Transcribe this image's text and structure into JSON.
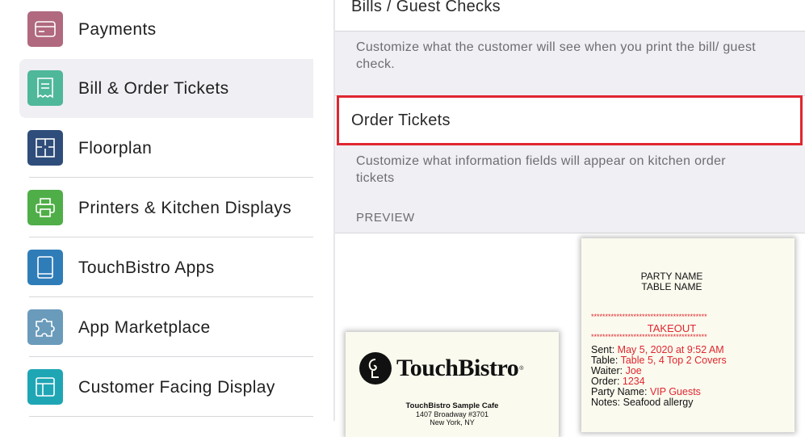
{
  "sidebar": {
    "items": [
      {
        "label": "Payments",
        "icon": "credit-card-icon",
        "color": "#b0697f",
        "selected": false
      },
      {
        "label": "Bill & Order Tickets",
        "icon": "receipt-icon",
        "color": "#4fb79a",
        "selected": true
      },
      {
        "label": "Floorplan",
        "icon": "floorplan-icon",
        "color": "#2f4d7a",
        "selected": false
      },
      {
        "label": "Printers & Kitchen Displays",
        "icon": "printer-icon",
        "color": "#4fae48",
        "selected": false
      },
      {
        "label": "TouchBistro Apps",
        "icon": "tablet-icon",
        "color": "#2f7db8",
        "selected": false
      },
      {
        "label": "App Marketplace",
        "icon": "puzzle-icon",
        "color": "#6a9bbb",
        "selected": false
      },
      {
        "label": "Customer Facing Display",
        "icon": "display-layout-icon",
        "color": "#1fa6b5",
        "selected": false
      }
    ]
  },
  "panel": {
    "bills_title": "Bills / Guest Checks",
    "bills_desc": "Customize what the customer will see when you print the bill/ guest check.",
    "order_title": "Order Tickets",
    "order_desc": "Customize what information fields will appear on kitchen order tickets",
    "preview_label": "PREVIEW"
  },
  "receipt_bill": {
    "logo": "TouchBistro",
    "trademark": "®",
    "cafe_name": "TouchBistro Sample Cafe",
    "address": "1407 Broadway #3701",
    "city": "New York, NY"
  },
  "receipt_order": {
    "party_name": "PARTY NAME",
    "table_name": "TABLE NAME",
    "stars": "*****************************************",
    "takeout": "TAKEOUT",
    "sent_label": "Sent: ",
    "sent_value": "May 5, 2020 at 9:52 AM",
    "table_label": "Table: ",
    "table_value": "Table 5, 4 Top 2 Covers",
    "waiter_label": "Waiter: ",
    "waiter_value": "Joe",
    "order_label": "Order: ",
    "order_value": "1234",
    "party_label": "Party Name: ",
    "party_value": "VIP Guests",
    "notes_label": "Notes: ",
    "notes_value": "Seafood allergy"
  },
  "colors": {
    "highlight": "#e0262f",
    "panel_bg": "#efeff4"
  }
}
